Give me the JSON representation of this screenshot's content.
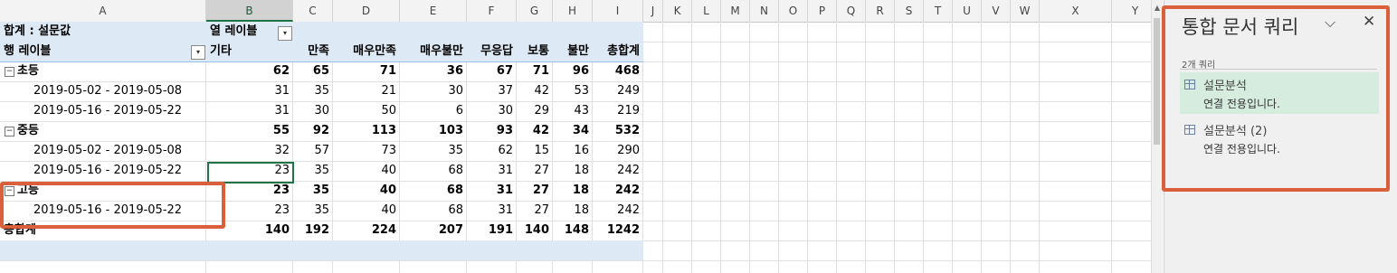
{
  "columns": [
    "A",
    "B",
    "C",
    "D",
    "E",
    "F",
    "G",
    "H",
    "I",
    "J",
    "K",
    "L",
    "M",
    "N",
    "O",
    "P",
    "Q",
    "R",
    "S",
    "T",
    "U",
    "V",
    "W",
    "X",
    "Y"
  ],
  "pivot": {
    "value_label": "합계 : 설문값",
    "col_label": "열 레이블",
    "row_label": "행 레이블",
    "headers": [
      "기타",
      "만족",
      "매우만족",
      "매우불만",
      "무응답",
      "보통",
      "불만",
      "총합계"
    ],
    "rows": [
      {
        "label": "초등",
        "type": "group",
        "values": [
          "62",
          "65",
          "71",
          "36",
          "67",
          "71",
          "96",
          "468"
        ]
      },
      {
        "label": "2019-05-02 - 2019-05-08",
        "type": "item",
        "values": [
          "31",
          "35",
          "21",
          "30",
          "37",
          "42",
          "53",
          "249"
        ]
      },
      {
        "label": "2019-05-16 - 2019-05-22",
        "type": "item",
        "values": [
          "31",
          "30",
          "50",
          "6",
          "30",
          "29",
          "43",
          "219"
        ]
      },
      {
        "label": "중등",
        "type": "group",
        "values": [
          "55",
          "92",
          "113",
          "103",
          "93",
          "42",
          "34",
          "532"
        ]
      },
      {
        "label": "2019-05-02 - 2019-05-08",
        "type": "item",
        "values": [
          "32",
          "57",
          "73",
          "35",
          "62",
          "15",
          "16",
          "290"
        ]
      },
      {
        "label": "2019-05-16 - 2019-05-22",
        "type": "item",
        "values": [
          "23",
          "35",
          "40",
          "68",
          "31",
          "27",
          "18",
          "242"
        ]
      },
      {
        "label": "고등",
        "type": "group",
        "values": [
          "23",
          "35",
          "40",
          "68",
          "31",
          "27",
          "18",
          "242"
        ]
      },
      {
        "label": "2019-05-16 - 2019-05-22",
        "type": "item",
        "values": [
          "23",
          "35",
          "40",
          "68",
          "31",
          "27",
          "18",
          "242"
        ]
      },
      {
        "label": "총합계",
        "type": "total",
        "values": [
          "140",
          "192",
          "224",
          "207",
          "191",
          "140",
          "148",
          "1242"
        ]
      }
    ]
  },
  "pane": {
    "title": "통합 문서 쿼리",
    "chevron": "⌵",
    "close": "✕",
    "count": "2개 쿼리",
    "queries": [
      {
        "name": "설문분석",
        "status": "연결 전용입니다."
      },
      {
        "name": "설문분석 (2)",
        "status": "연결 전용입니다."
      }
    ]
  },
  "colors": {
    "accent": "#217346",
    "highlight_box": "#d9603b",
    "pivot_header": "#dde9f5",
    "pane_selected": "#d5ecdf"
  }
}
